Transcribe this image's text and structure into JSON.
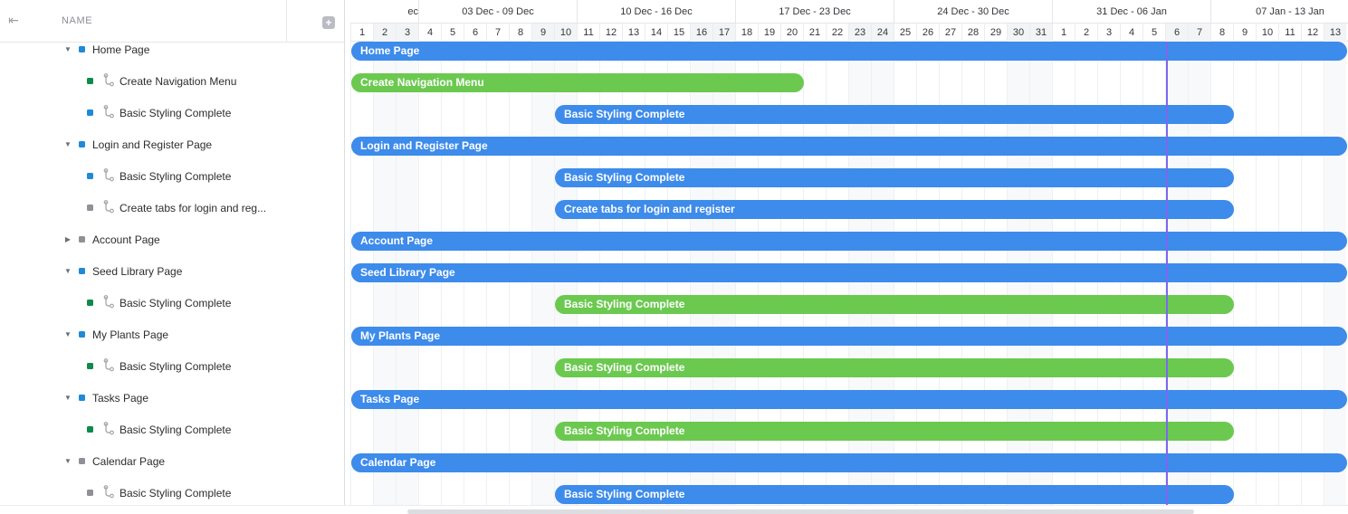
{
  "header": {
    "name_label": "NAME"
  },
  "colors": {
    "blue": "#3d8bea",
    "green": "#6bc950",
    "sq_blue": "#1f8ad8",
    "sq_green": "#0f8a4a",
    "sq_gray": "#8e9198",
    "today": "#7b68ee"
  },
  "weeks": [
    "ec",
    "03 Dec - 09 Dec",
    "10 Dec - 16 Dec",
    "17 Dec - 23 Dec",
    "24 Dec - 30 Dec",
    "31 Dec - 06 Jan",
    "07 Jan - 13 Jan"
  ],
  "days": [
    1,
    2,
    3,
    4,
    5,
    6,
    7,
    8,
    9,
    10,
    11,
    12,
    13,
    14,
    15,
    16,
    17,
    18,
    19,
    20,
    21,
    22,
    23,
    24,
    25,
    26,
    27,
    28,
    29,
    30,
    31,
    1,
    2,
    3,
    4,
    5,
    6,
    7,
    8,
    9,
    10,
    11,
    12,
    13
  ],
  "today_day_index": 36,
  "rows": [
    {
      "label": "Home Page",
      "level": 0,
      "caret": "down",
      "sq": "blue",
      "bar": {
        "label": "Home Page",
        "start": 0,
        "end": 44,
        "color": "blue"
      }
    },
    {
      "label": "Create Navigation Menu",
      "level": 1,
      "sq": "green",
      "bar": {
        "label": "Create Navigation Menu",
        "start": 0,
        "end": 20,
        "color": "green"
      }
    },
    {
      "label": "Basic Styling Complete",
      "level": 1,
      "sq": "blue",
      "bar": {
        "label": "Basic Styling Complete",
        "start": 9,
        "end": 39,
        "color": "blue"
      }
    },
    {
      "label": "Login and Register Page",
      "level": 0,
      "caret": "down",
      "sq": "blue",
      "bar": {
        "label": "Login and Register Page",
        "start": 0,
        "end": 44,
        "color": "blue"
      }
    },
    {
      "label": "Basic Styling Complete",
      "level": 1,
      "sq": "blue",
      "bar": {
        "label": "Basic Styling Complete",
        "start": 9,
        "end": 39,
        "color": "blue"
      }
    },
    {
      "label": "Create tabs for login and reg...",
      "level": 1,
      "sq": "gray",
      "bar": {
        "label": "Create tabs for login and register",
        "start": 9,
        "end": 39,
        "color": "blue"
      }
    },
    {
      "label": "Account Page",
      "level": 0,
      "caret": "right",
      "sq": "gray",
      "bar": {
        "label": "Account Page",
        "start": 0,
        "end": 44,
        "color": "blue"
      }
    },
    {
      "label": "Seed Library Page",
      "level": 0,
      "caret": "down",
      "sq": "blue",
      "bar": {
        "label": "Seed Library Page",
        "start": 0,
        "end": 44,
        "color": "blue"
      }
    },
    {
      "label": "Basic Styling Complete",
      "level": 1,
      "sq": "green",
      "bar": {
        "label": "Basic Styling Complete",
        "start": 9,
        "end": 39,
        "color": "green"
      }
    },
    {
      "label": "My Plants Page",
      "level": 0,
      "caret": "down",
      "sq": "blue",
      "bar": {
        "label": "My Plants Page",
        "start": 0,
        "end": 44,
        "color": "blue"
      }
    },
    {
      "label": "Basic Styling Complete",
      "level": 1,
      "sq": "green",
      "bar": {
        "label": "Basic Styling Complete",
        "start": 9,
        "end": 39,
        "color": "green"
      }
    },
    {
      "label": "Tasks Page",
      "level": 0,
      "caret": "down",
      "sq": "blue",
      "bar": {
        "label": "Tasks Page",
        "start": 0,
        "end": 44,
        "color": "blue"
      }
    },
    {
      "label": "Basic Styling Complete",
      "level": 1,
      "sq": "green",
      "bar": {
        "label": "Basic Styling Complete",
        "start": 9,
        "end": 39,
        "color": "green"
      }
    },
    {
      "label": "Calendar Page",
      "level": 0,
      "caret": "down",
      "sq": "gray",
      "bar": {
        "label": "Calendar Page",
        "start": 0,
        "end": 44,
        "color": "blue"
      }
    },
    {
      "label": "Basic Styling Complete",
      "level": 1,
      "sq": "gray",
      "bar": {
        "label": "Basic Styling Complete",
        "start": 9,
        "end": 39,
        "color": "blue"
      }
    }
  ]
}
